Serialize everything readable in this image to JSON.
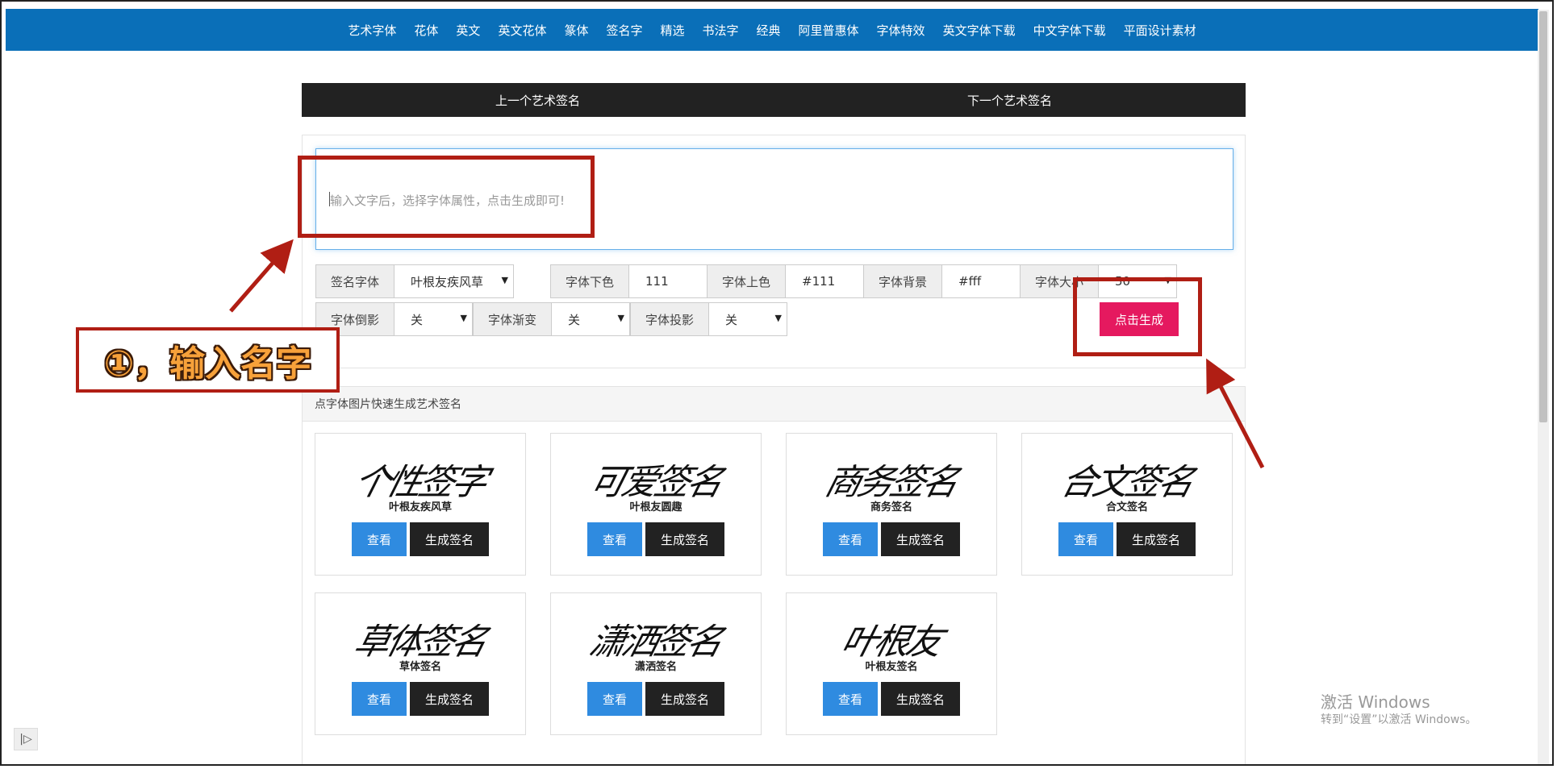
{
  "nav": {
    "items": [
      "艺术字体",
      "花体",
      "英文",
      "英文花体",
      "篆体",
      "签名字",
      "精选",
      "书法字",
      "经典",
      "阿里普惠体",
      "字体特效",
      "英文字体下载",
      "中文字体下载",
      "平面设计素材"
    ]
  },
  "prevnext": {
    "prev": "上一个艺术签名",
    "next": "下一个艺术签名"
  },
  "form": {
    "placeholder": "输入文字后，选择字体属性，点击生成即可!",
    "font_label": "签名字体",
    "font_value": "叶根友疾风草",
    "bottom_color_label": "字体下色",
    "bottom_color_value": "111",
    "top_color_label": "字体上色",
    "top_color_value": "#111",
    "bg_label": "字体背景",
    "bg_value": "#fff",
    "size_label": "字体大小",
    "size_value": "50",
    "reflect_label": "字体倒影",
    "reflect_value": "关",
    "gradient_label": "字体渐变",
    "gradient_value": "关",
    "shadow_label": "字体投影",
    "shadow_value": "关",
    "generate": "点击生成"
  },
  "gallery": {
    "heading": "点字体图片快速生成艺术签名",
    "view_label": "查看",
    "gen_label": "生成签名",
    "cards": [
      {
        "name": "叶根友疾风草",
        "sample": "个性签字"
      },
      {
        "name": "叶根友圆趣",
        "sample": "可爱签名"
      },
      {
        "name": "商务签名",
        "sample": "商务签名"
      },
      {
        "name": "合文签名",
        "sample": "合文签名"
      },
      {
        "name": "草体签名",
        "sample": "草体签名"
      },
      {
        "name": "潇洒签名",
        "sample": "潇洒签名"
      },
      {
        "name": "叶根友签名",
        "sample": "叶根友"
      }
    ]
  },
  "annotation": {
    "callout": "①，输入名字",
    "color": "#b01e14"
  },
  "watermark": {
    "title": "激活 Windows",
    "subtitle": "转到“设置”以激活 Windows。"
  },
  "colors": {
    "nav": "#0a6fb8",
    "generate": "#e5195f",
    "view": "#2f8be0",
    "dark": "#222222"
  }
}
